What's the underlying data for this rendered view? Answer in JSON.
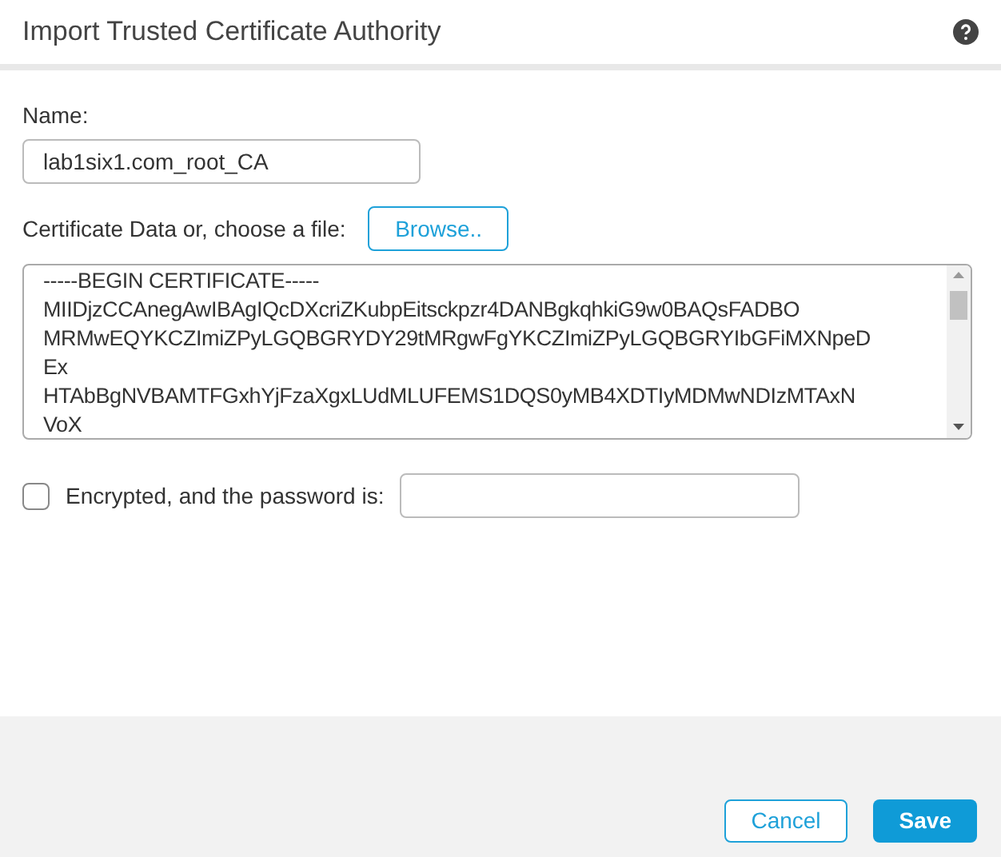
{
  "dialog": {
    "title": "Import Trusted Certificate Authority"
  },
  "name_field": {
    "label": "Name:",
    "value": "lab1six1.com_root_CA"
  },
  "certificate": {
    "label": "Certificate Data or, choose a file:",
    "browse_button": "Browse..",
    "lines": [
      "-----BEGIN CERTIFICATE-----",
      "MIIDjzCCAnegAwIBAgIQcDXcriZKubpEitsckpzr4DANBgkqhkiG9w0BAQsFADBO",
      "MRMwEQYKCZImiZPyLGQBGRYDY29tMRgwFgYKCZImiZPyLGQBGRYIbGFiMXNpeD",
      "Ex",
      "HTAbBgNVBAMTFGxhYjFzaXgxLUdMLUFEMS1DQS0yMB4XDTIyMDMwNDIzMTAxN",
      "VoX"
    ]
  },
  "encrypted": {
    "label": "Encrypted, and the password is:",
    "checked": false
  },
  "buttons": [
    {
      "label": "Cancel",
      "kind": "secondary"
    },
    {
      "label": "Save",
      "kind": "primary"
    }
  ]
}
